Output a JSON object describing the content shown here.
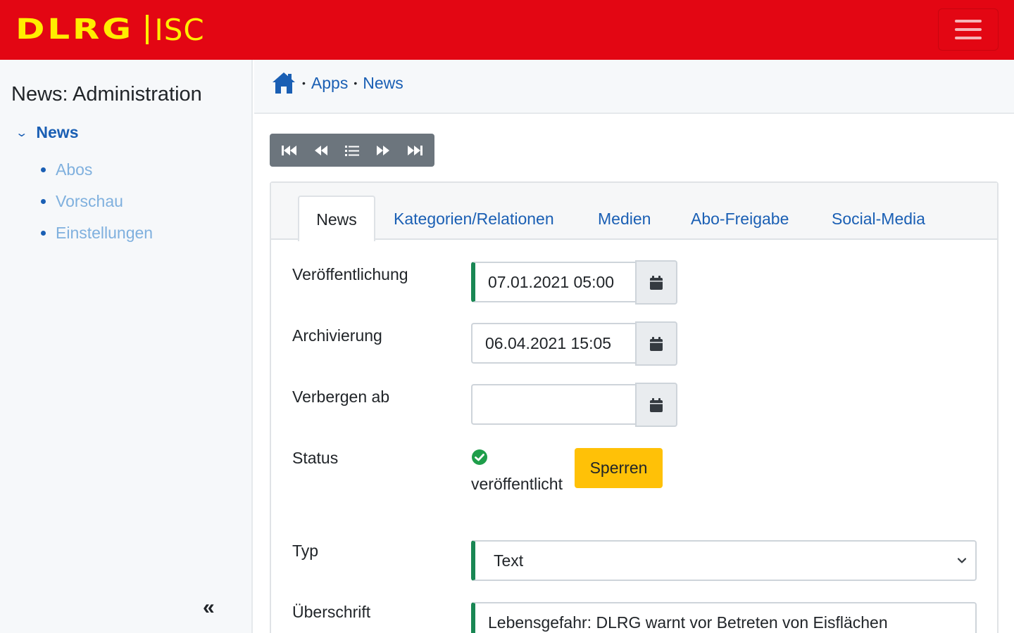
{
  "header": {
    "logo_primary": "DLRG",
    "logo_secondary": "ISC",
    "menu_icon": "hamburger-icon",
    "colors": {
      "brand_red": "#e30613",
      "brand_yellow": "#ffed00"
    }
  },
  "sidebar": {
    "title": "News: Administration",
    "root": {
      "label": "News",
      "icon": "chevron-down-icon"
    },
    "items": [
      {
        "label": "Abos"
      },
      {
        "label": "Vorschau"
      },
      {
        "label": "Einstellungen"
      }
    ],
    "collapse_label": "«"
  },
  "breadcrumb": {
    "home_icon": "home-icon",
    "items": [
      "Apps",
      "News"
    ],
    "separator": "•"
  },
  "pager": {
    "buttons": [
      "first-icon",
      "previous-icon",
      "list-icon",
      "next-icon",
      "last-icon"
    ]
  },
  "tabs": [
    {
      "label": "News",
      "active": true
    },
    {
      "label": "Kategorien/Relationen",
      "active": false
    },
    {
      "label": "Medien",
      "active": false
    },
    {
      "label": "Abo-Freigabe",
      "active": false
    },
    {
      "label": "Social-Media",
      "active": false
    }
  ],
  "form": {
    "publication": {
      "label": "Veröffentlichung",
      "value": "07.01.2021 05:00"
    },
    "archive": {
      "label": "Archivierung",
      "value": "06.04.2021 15:05"
    },
    "hide_from": {
      "label": "Verbergen ab",
      "value": ""
    },
    "status": {
      "label": "Status",
      "value": "veröffentlicht",
      "icon": "check-circle-icon",
      "action_label": "Sperren"
    },
    "type": {
      "label": "Typ",
      "value": "Text"
    },
    "headline": {
      "label": "Überschrift",
      "value": "Lebensgefahr: DLRG warnt vor Betreten von Eisflächen"
    }
  },
  "colors": {
    "link": "#1a5fb4",
    "success": "#198754",
    "warning": "#ffc107",
    "secondary": "#6c757d"
  }
}
